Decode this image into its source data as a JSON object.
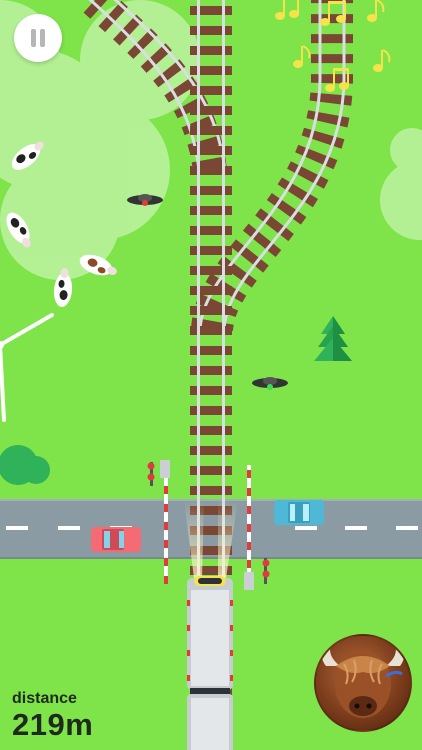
{
  "hud": {
    "distance_label": "distance",
    "distance_value": "219m"
  },
  "controls": {
    "pause_icon": "pause-icon"
  },
  "signals": {
    "drone_top_light": "red",
    "drone_bottom_light": "green"
  },
  "colors": {
    "grass": "#7ee44a",
    "road": "#8a9ba3",
    "sleeper": "#7b4735",
    "rail": "#d9dee3",
    "music_note": "#f4e34a",
    "car_red": "#f46b73",
    "car_blue": "#4fb8d6",
    "tree": "#2fb25a"
  },
  "player": {
    "avatar_icon": "highland-cow-avatar"
  }
}
